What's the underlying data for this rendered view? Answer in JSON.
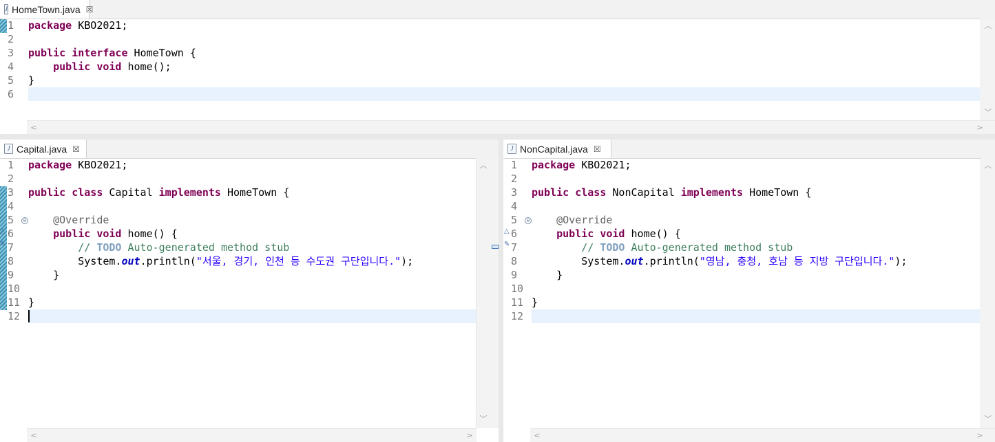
{
  "editors": {
    "top": {
      "tab_label": "HomeTown.java",
      "lines": [
        "1",
        "2",
        "3",
        "4",
        "5",
        "6"
      ]
    },
    "left": {
      "tab_label": "Capital.java",
      "lines": [
        "1",
        "2",
        "3",
        "4",
        "5",
        "6",
        "7",
        "8",
        "9",
        "10",
        "11",
        "12"
      ]
    },
    "right": {
      "tab_label": "NonCapital.java",
      "lines": [
        "1",
        "2",
        "3",
        "4",
        "5",
        "6",
        "7",
        "8",
        "9",
        "10",
        "11",
        "12"
      ]
    }
  },
  "code": {
    "top": {
      "l1_kw": "package",
      "l1_rest": " KBO2021;",
      "l3_kw1": "public",
      "l3_kw2": "interface",
      "l3_rest": " HomeTown {",
      "l4_indent": "    ",
      "l4_kw1": "public",
      "l4_kw2": "void",
      "l4_rest": " home();",
      "l5": "}"
    },
    "left": {
      "l1_kw": "package",
      "l1_rest": " KBO2021;",
      "l3_kw1": "public",
      "l3_kw2": "class",
      "l3_name": " Capital ",
      "l3_kw3": "implements",
      "l3_rest": " HomeTown {",
      "l5_indent": "    ",
      "l5_ann": "@Override",
      "l6_indent": "    ",
      "l6_kw1": "public",
      "l6_kw2": "void",
      "l6_rest": " home() {",
      "l7_indent": "        ",
      "l7_com1": "// ",
      "l7_todo": "TODO",
      "l7_com2": " Auto-generated method stub",
      "l8_indent": "        ",
      "l8_pre": "System.",
      "l8_fld": "out",
      "l8_mid": ".println(",
      "l8_str": "\"서울, 경기, 인천 등 수도권 구단입니다.\"",
      "l8_end": ");",
      "l9": "    }",
      "l11": "}"
    },
    "right": {
      "l1_kw": "package",
      "l1_rest": " KBO2021;",
      "l3_kw1": "public",
      "l3_kw2": "class",
      "l3_name": " NonCapital ",
      "l3_kw3": "implements",
      "l3_rest": " HomeTown {",
      "l5_indent": "    ",
      "l5_ann": "@Override",
      "l6_indent": "    ",
      "l6_kw1": "public",
      "l6_kw2": "void",
      "l6_rest": " home() {",
      "l7_indent": "        ",
      "l7_com1": "// ",
      "l7_todo": "TODO",
      "l7_com2": " Auto-generated method stub",
      "l8_indent": "        ",
      "l8_pre": "System.",
      "l8_fld": "out",
      "l8_mid": ".println(",
      "l8_str": "\"영남, 충청, 호남 등 지방 구단입니다.\"",
      "l8_end": ");",
      "l9": "    }",
      "l11": "}"
    }
  },
  "glyphs": {
    "close": "☒",
    "file_letter": "J",
    "fold": "⊖",
    "up": "︿",
    "down": "﹀",
    "left": "<",
    "right": ">"
  }
}
